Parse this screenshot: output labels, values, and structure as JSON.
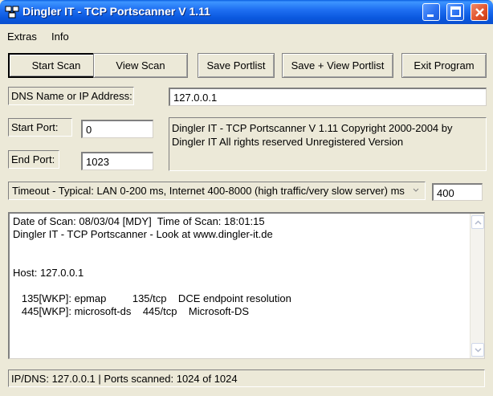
{
  "window": {
    "title": "Dingler IT - TCP Portscanner V 1.11"
  },
  "menu": {
    "extras": "Extras",
    "info": "Info"
  },
  "toolbar": {
    "start_scan": "Start Scan",
    "view_scan": "View Scan",
    "save_portlist": "Save Portlist",
    "save_view_portlist": "Save + View Portlist",
    "exit_program": "Exit Program"
  },
  "form": {
    "dns_label": "DNS Name or IP Address:",
    "dns_value": "127.0.0.1",
    "start_port_label": "Start Port:",
    "start_port_value": "0",
    "end_port_label": "End Port:",
    "end_port_value": "1023",
    "info_text": "Dingler IT - TCP Portscanner V 1.11 Copyright 2000-2004 by Dingler IT All rights reserved  Unregistered Version",
    "timeout_text": "Timeout  - Typical: LAN 0-200 ms, Internet 400-8000 (high traffic/very slow server) ms",
    "timeout_value": "400"
  },
  "result": {
    "text": "Date of Scan: 08/03/04 [MDY]  Time of Scan: 18:01:15\nDingler IT - TCP Portscanner - Look at www.dingler-it.de\n\n\nHost: 127.0.0.1\n\n   135[WKP]: epmap         135/tcp    DCE endpoint resolution\n   445[WKP]: microsoft-ds    445/tcp    Microsoft-DS"
  },
  "status": {
    "text": "IP/DNS: 127.0.0.1 | Ports scanned: 1024 of 1024"
  },
  "colors": {
    "titlebar": "#0A58DE",
    "window_bg": "#ECE9D8",
    "close_button": "#E0512A"
  }
}
